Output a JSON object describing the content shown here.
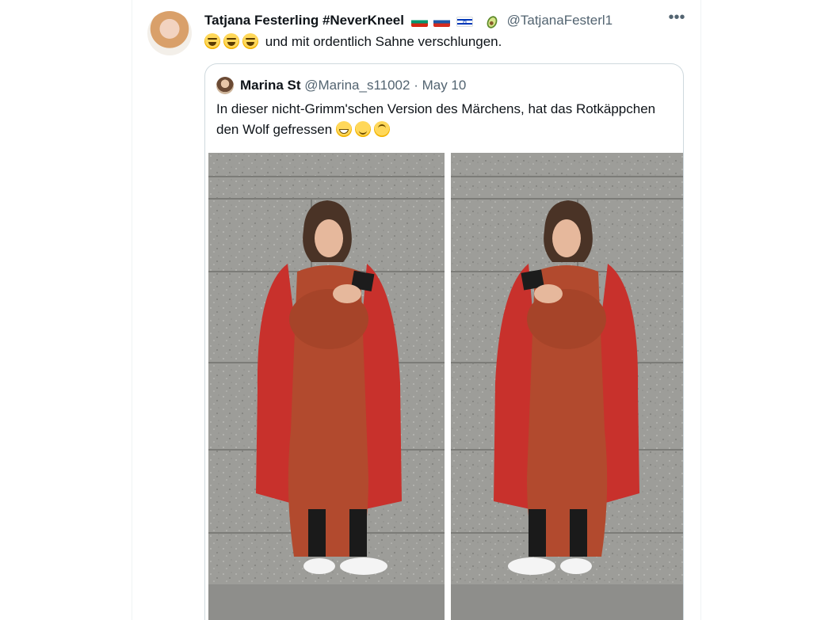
{
  "tweet": {
    "author_name": "Tatjana Festerling #NeverKneel",
    "handle": "@TatjanaFesterl1",
    "flags": [
      "flag-bulgaria",
      "flag-russia",
      "flag-israel"
    ],
    "badge_icon": "avocado-icon",
    "text": "und mit ordentlich Sahne verschlungen.",
    "emojis": [
      "face-with-tears-of-joy",
      "face-with-tears-of-joy",
      "face-with-tears-of-joy"
    ]
  },
  "quoted": {
    "author_name": "Marina St",
    "handle": "@Marina_s11002",
    "separator": "·",
    "date": "May 10",
    "text": "In dieser nicht-Grimm'schen Version des Märchens, hat das Rotkäppchen den Wolf gefressen",
    "emojis": [
      "grinning-face",
      "winking-face",
      "upside-down-face"
    ]
  },
  "colors": {
    "text": "#0f1419",
    "secondary": "#536471",
    "border": "#cfd9de",
    "coat": "#c8312c",
    "dress": "#b24a2e",
    "wall": "#9a9a96"
  }
}
